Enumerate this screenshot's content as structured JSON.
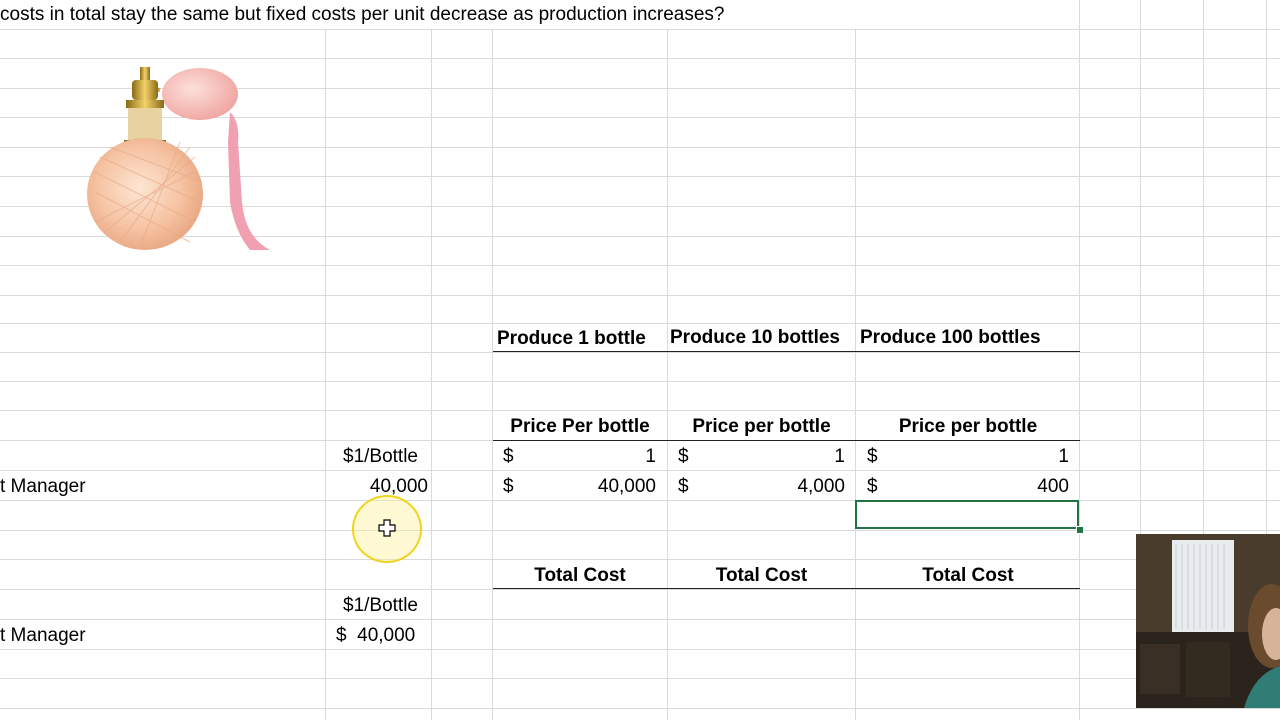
{
  "question": "costs in total stay the same but fixed costs per unit decrease as production increases?",
  "columns": {
    "produce_1": "Produce 1 bottle",
    "produce_10": "Produce 10 bottles",
    "produce_100": "Produce 100 bottles"
  },
  "price_headers": {
    "col1": "Price Per bottle",
    "col2": "Price per bottle",
    "col3": "Price per bottle"
  },
  "rows": {
    "row1_unit": "$1/Bottle",
    "row2_label": "t Manager",
    "row2_value": "40,000",
    "row3_unit": "$1/Bottle",
    "row4_label": "t Manager",
    "row4_value": "$  40,000"
  },
  "price_row_1": [
    {
      "sym": "$",
      "val": "1"
    },
    {
      "sym": "$",
      "val": "1"
    },
    {
      "sym": "$",
      "val": "1"
    }
  ],
  "price_row_2": [
    {
      "sym": "$",
      "val": "40,000"
    },
    {
      "sym": "$",
      "val": "4,000"
    },
    {
      "sym": "$",
      "val": "400"
    }
  ],
  "total_headers": {
    "col1": "Total Cost",
    "col2": "Total Cost",
    "col3": "Total Cost"
  },
  "colors": {
    "gridline": "#d4d4d4",
    "selection": "#217346",
    "cursor_highlight": "#f2d21b"
  }
}
